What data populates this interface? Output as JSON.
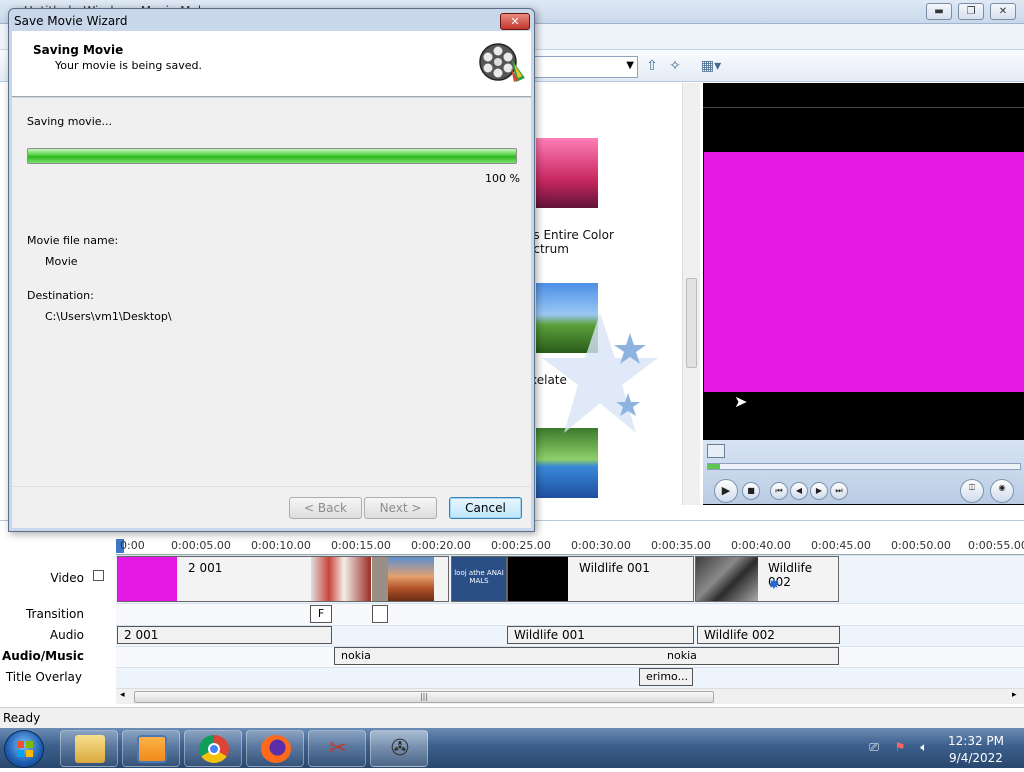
{
  "main_window": {
    "title": "Untitled - Windows Movie Maker"
  },
  "contents": {
    "items": [
      {
        "label_line1": "es Entire Color",
        "label_line2": "ectrum"
      },
      {
        "label_line1": "xelate",
        "label_line2": ""
      }
    ]
  },
  "timeline": {
    "ticks": [
      "0:00",
      "0:00:05.00",
      "0:00:10.00",
      "0:00:15.00",
      "0:00:20.00",
      "0:00:25.00",
      "0:00:30.00",
      "0:00:35.00",
      "0:00:40.00",
      "0:00:45.00",
      "0:00:50.00",
      "0:00:55.00"
    ],
    "tracks": {
      "video": "Video",
      "transition": "Transition",
      "audio": "Audio",
      "audio_music": "Audio/Music",
      "title_overlay": "Title Overlay"
    },
    "video_clips": [
      {
        "label": "2 001"
      },
      {
        "label": "looj athe ANAI MALS"
      },
      {
        "label": "Wildlife 001"
      },
      {
        "label": "Wildlife 002"
      }
    ],
    "transition_marks": [
      "F",
      ""
    ],
    "audio_clips": [
      {
        "label": "2 001"
      },
      {
        "label": "Wildlife 001"
      },
      {
        "label": "Wildlife 002"
      }
    ],
    "music_clips": [
      {
        "label": "nokia"
      },
      {
        "label": "nokia"
      }
    ],
    "overlay_clips": [
      {
        "label": "erimo..."
      }
    ],
    "collapse_symbol": "−"
  },
  "status": {
    "text": "Ready"
  },
  "taskbar": {
    "time": "12:32 PM",
    "date": "9/4/2022"
  },
  "dialog": {
    "title": "Save Movie Wizard",
    "close_symbol": "✕",
    "header_title": "Saving Movie",
    "header_subtitle": "Your movie is being saved.",
    "status_label": "Saving movie...",
    "progress": 1.0,
    "progress_text": "100 %",
    "file_name_label": "Movie file name:",
    "file_name": "Movie",
    "destination_label": "Destination:",
    "destination": "C:\\Users\\vm1\\Desktop\\",
    "back_label": "< Back",
    "next_label": "Next >",
    "cancel_label": "Cancel"
  },
  "colors": {
    "preview_clip": "#e419e4",
    "progress_green": "#2cb51e",
    "accent": "#3c7fb1"
  },
  "icons": [
    "film-reel-icon",
    "play-icon",
    "stop-icon",
    "rewind-icon",
    "fast-forward-icon",
    "split-icon",
    "snapshot-icon",
    "fullscreen-icon"
  ]
}
